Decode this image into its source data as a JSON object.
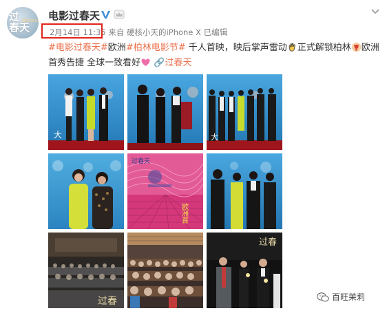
{
  "account": {
    "avatar_text_line1": "过",
    "avatar_text_line2": "春天",
    "avatar_script": "Blossom",
    "username": "电影过春天"
  },
  "meta": {
    "time": "2月14日 11:35",
    "from_label": " 来自 ",
    "device": "硬核小天的iPhone X",
    "edited": " 已编辑"
  },
  "post": {
    "tag_movie": "#电影过春天#",
    "text_europe": "欧洲",
    "tag_festival": "#柏林电影节#",
    "text1": " 千人首映，映后掌声雷动",
    "text2": "正式解锁柏林",
    "text3": "欧洲首秀告捷  全球一致看好",
    "link_text": "过春天"
  },
  "photos": [
    {
      "id": "photo-1",
      "desc": "premiere-photocall"
    },
    {
      "id": "photo-2",
      "desc": "premiere-photocall"
    },
    {
      "id": "photo-3",
      "desc": "premiere-photocall"
    },
    {
      "id": "photo-4",
      "desc": "two-actresses"
    },
    {
      "id": "photo-5",
      "desc": "poster"
    },
    {
      "id": "photo-6",
      "desc": "premiere-photocall"
    },
    {
      "id": "photo-7",
      "desc": "cinema-audience"
    },
    {
      "id": "photo-8",
      "desc": "cinema-audience"
    },
    {
      "id": "photo-9",
      "desc": "stage-with-flowers"
    }
  ],
  "poster": {
    "title_small": "过春天",
    "side_text": "欧洲首"
  },
  "photo7_overlay": "过春",
  "photo9_overlay": "过春",
  "watermark": "百旺茉莉",
  "colors": {
    "link": "#eb7350",
    "highlight_box": "#e2231a",
    "backdrop_blue": "#2c8fd0"
  }
}
